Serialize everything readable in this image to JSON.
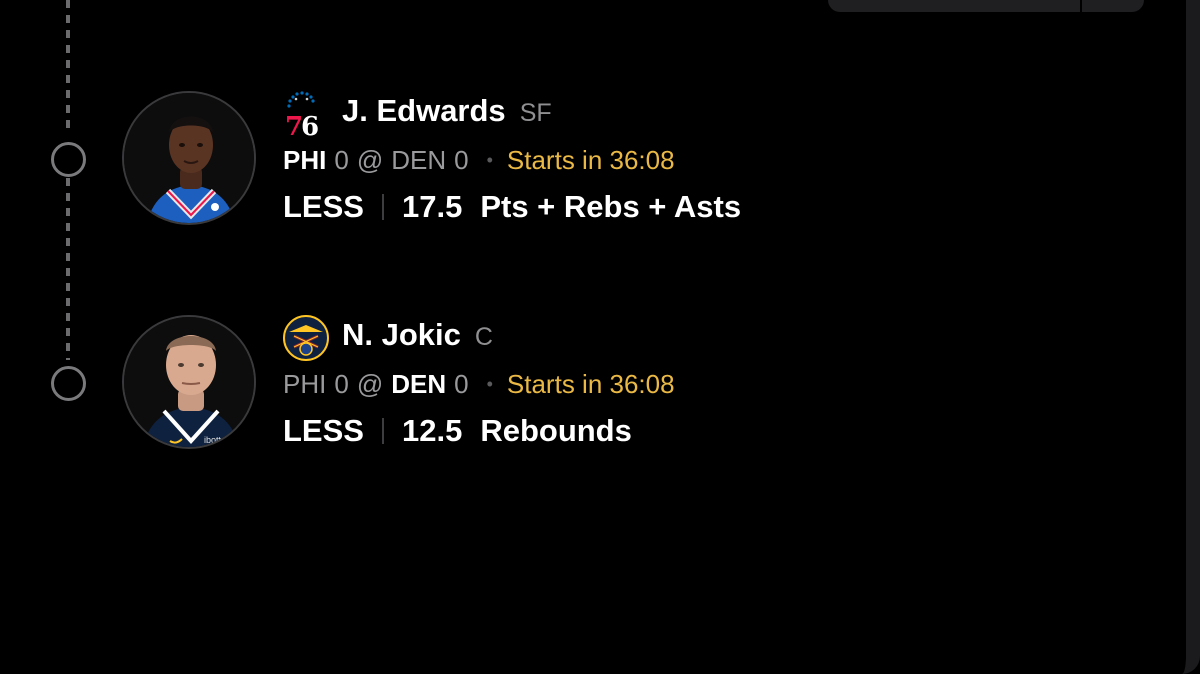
{
  "picks": [
    {
      "player_name": "J. Edwards",
      "position": "SF",
      "team_logo": "sixers-76-logo",
      "away_team": "PHI",
      "away_score": "0",
      "at": "@",
      "home_team": "DEN",
      "home_score": "0",
      "bullet": "•",
      "starts": "Starts in 36:08",
      "direction": "LESS",
      "line": "17.5",
      "stat": "Pts + Rebs + Asts",
      "highlight_team": "PHI"
    },
    {
      "player_name": "N. Jokic",
      "position": "C",
      "team_logo": "nuggets-logo",
      "away_team": "PHI",
      "away_score": "0",
      "at": "@",
      "home_team": "DEN",
      "home_score": "0",
      "bullet": "•",
      "starts": "Starts in 36:08",
      "direction": "LESS",
      "line": "12.5",
      "stat": "Rebounds",
      "highlight_team": "DEN"
    }
  ],
  "colors": {
    "background": "#000000",
    "starts_text": "#e9b845",
    "muted_text": "#9a9a9d",
    "sixers_red": "#ed174c",
    "sixers_blue": "#006bb6",
    "nuggets_navy": "#0e2240",
    "nuggets_gold": "#fec524"
  }
}
